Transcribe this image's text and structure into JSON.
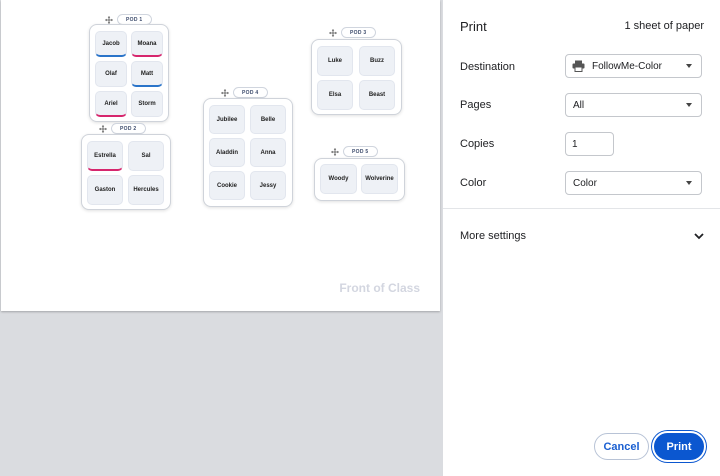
{
  "preview": {
    "front_label": "Front of Class",
    "pods": [
      {
        "tag": "POD 1",
        "seats": [
          "Jacob",
          "Moana",
          "Olaf",
          "Matt",
          "Ariel",
          "Storm"
        ]
      },
      {
        "tag": "POD 2",
        "seats": [
          "Estrella",
          "Sal",
          "Gaston",
          "Hercules"
        ]
      },
      {
        "tag": "POD 3",
        "seats": [
          "Luke",
          "Buzz",
          "Elsa",
          "Beast"
        ]
      },
      {
        "tag": "POD 4",
        "seats": [
          "Jubilee",
          "Belle",
          "Aladdin",
          "Anna",
          "Cookie",
          "Jessy"
        ]
      },
      {
        "tag": "POD 5",
        "seats": [
          "Woody",
          "Wolverine"
        ]
      }
    ]
  },
  "panel": {
    "title": "Print",
    "sheets": "1 sheet of paper",
    "destination": {
      "label": "Destination",
      "value": "FollowMe-Color",
      "icon": "printer-icon"
    },
    "pages": {
      "label": "Pages",
      "value": "All"
    },
    "copies": {
      "label": "Copies",
      "value": "1"
    },
    "color": {
      "label": "Color",
      "value": "Color"
    },
    "more_settings": "More settings",
    "cancel": "Cancel",
    "print": "Print"
  }
}
